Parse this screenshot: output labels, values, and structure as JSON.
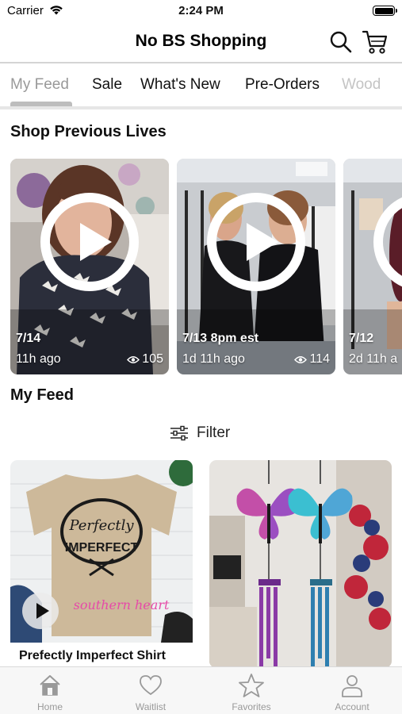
{
  "status_bar": {
    "carrier": "Carrier",
    "time": "2:24 PM"
  },
  "header": {
    "title": "No BS Shopping",
    "icons": [
      "search-icon",
      "cart-icon"
    ]
  },
  "tabs": [
    {
      "label": "My Feed",
      "active": true
    },
    {
      "label": "Sale"
    },
    {
      "label": "What's New"
    },
    {
      "label": "Pre-Orders"
    },
    {
      "label": "Wood"
    }
  ],
  "previous_lives": {
    "title": "Shop Previous Lives",
    "items": [
      {
        "date": "7/14",
        "ago": "11h ago",
        "views": "105"
      },
      {
        "date": "7/13 8pm est",
        "ago": "1d 11h ago",
        "views": "114"
      },
      {
        "date": "7/12",
        "ago": "2d 11h a"
      }
    ]
  },
  "feed": {
    "title": "My Feed",
    "filter_label": "Filter",
    "products": [
      {
        "name": "Prefectly Imperfect Shirt",
        "shirt_text": [
          "Perfectly",
          "IMPERFECT"
        ],
        "watermark": "southern heart",
        "has_video": true
      },
      {
        "name": ""
      }
    ]
  },
  "tab_bar": {
    "items": [
      {
        "label": "Home",
        "icon": "home-icon"
      },
      {
        "label": "Waitlist",
        "icon": "heart-icon"
      },
      {
        "label": "Favorites",
        "icon": "star-icon"
      },
      {
        "label": "Account",
        "icon": "account-icon"
      }
    ]
  },
  "colors": {
    "accent_inactive": "#999999",
    "tab_indicator": "#bdbdbd",
    "divider": "#d4d4d4"
  }
}
